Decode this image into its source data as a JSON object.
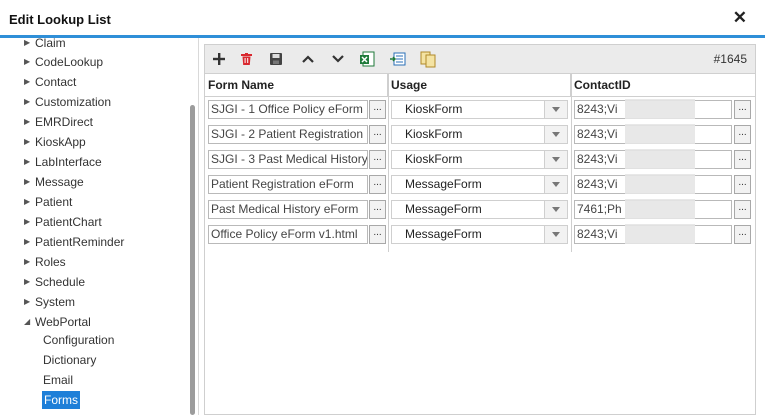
{
  "window": {
    "title": "Edit Lookup List",
    "close_glyph": "✕"
  },
  "tree": {
    "items": [
      {
        "label": "Claim",
        "state": "collapsed"
      },
      {
        "label": "CodeLookup",
        "state": "collapsed"
      },
      {
        "label": "Contact",
        "state": "collapsed"
      },
      {
        "label": "Customization",
        "state": "collapsed"
      },
      {
        "label": "EMRDirect",
        "state": "collapsed"
      },
      {
        "label": "KioskApp",
        "state": "collapsed"
      },
      {
        "label": "LabInterface",
        "state": "collapsed"
      },
      {
        "label": "Message",
        "state": "collapsed"
      },
      {
        "label": "Patient",
        "state": "collapsed"
      },
      {
        "label": "PatientChart",
        "state": "collapsed"
      },
      {
        "label": "PatientReminder",
        "state": "collapsed"
      },
      {
        "label": "Roles",
        "state": "collapsed"
      },
      {
        "label": "Schedule",
        "state": "collapsed"
      },
      {
        "label": "System",
        "state": "collapsed"
      },
      {
        "label": "WebPortal",
        "state": "expanded"
      }
    ],
    "children": [
      {
        "label": "Configuration",
        "selected": false
      },
      {
        "label": "Dictionary",
        "selected": false
      },
      {
        "label": "Email",
        "selected": false
      },
      {
        "label": "Forms",
        "selected": true
      }
    ]
  },
  "toolbar": {
    "buttons": [
      {
        "icon": "add-icon"
      },
      {
        "icon": "delete-icon"
      },
      {
        "icon": "save-icon"
      },
      {
        "icon": "move-up-icon"
      },
      {
        "icon": "move-down-icon"
      },
      {
        "icon": "excel-export-icon"
      },
      {
        "icon": "import-icon"
      },
      {
        "icon": "copy-icon"
      }
    ],
    "record_count": "#1645"
  },
  "grid": {
    "columns": [
      "Form Name",
      "Usage",
      "ContactID"
    ],
    "rows": [
      {
        "form_name": "SJGI - 1 Office Policy eForm",
        "usage": "KioskForm",
        "contact_id": "8243;Vi"
      },
      {
        "form_name": "SJGI - 2 Patient Registration",
        "usage": "KioskForm",
        "contact_id": "8243;Vi"
      },
      {
        "form_name": "SJGI - 3 Past Medical History",
        "usage": "KioskForm",
        "contact_id": "8243;Vi"
      },
      {
        "form_name": "Patient Registration eForm",
        "usage": "MessageForm",
        "contact_id": "8243;Vi"
      },
      {
        "form_name": "Past Medical History eForm",
        "usage": "MessageForm",
        "contact_id": "7461;Ph"
      },
      {
        "form_name": "Office Policy eForm v1.html",
        "usage": "MessageForm",
        "contact_id": "8243;Vi"
      }
    ],
    "ellipsis_label": "..."
  },
  "colors": {
    "accent": "#2f8fd8",
    "selection": "#1e7fd8",
    "delete_red": "#d9282f",
    "excel_green": "#1f7a3a"
  }
}
